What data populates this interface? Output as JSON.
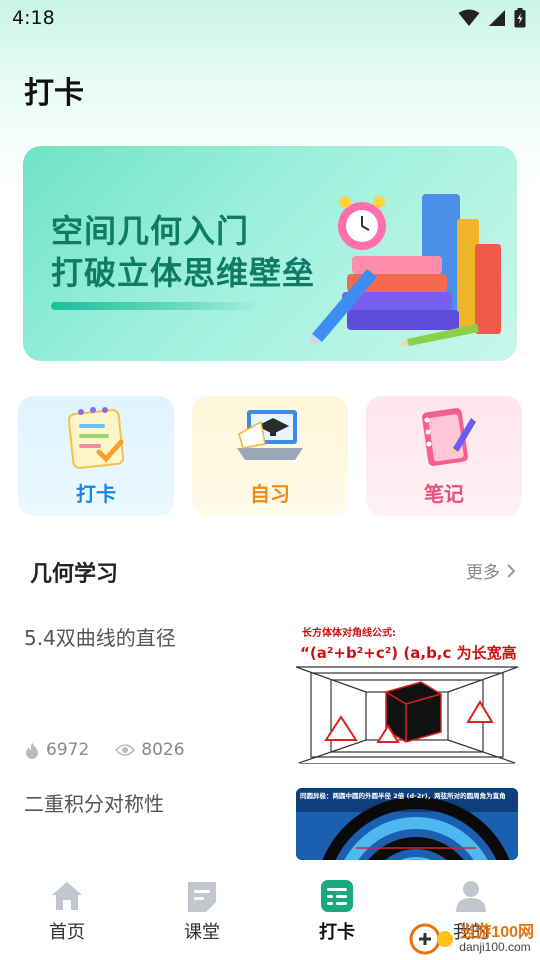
{
  "status_bar": {
    "time": "4:18"
  },
  "page": {
    "title": "打卡"
  },
  "banner": {
    "line1": "空间几何入门",
    "line2": "打破立体思维壁垒"
  },
  "feature_cards": [
    {
      "label": "打卡",
      "icon": "checklist-icon"
    },
    {
      "label": "自习",
      "icon": "laptop-graduation-icon"
    },
    {
      "label": "笔记",
      "icon": "notebook-icon"
    }
  ],
  "section": {
    "title": "几何学习",
    "more": "更多"
  },
  "articles": [
    {
      "title": "5.4双曲线的直径",
      "hot": "6972",
      "views": "8026",
      "thumb": {
        "heading": "长方体体对角线公式:",
        "formula": "“(a²+b²+c²) (a,b,c 为长宽高)"
      }
    },
    {
      "title": "二重积分对称性",
      "thumb": {
        "heading": "同圆异极：两圆中圆的外圆半径 2倍 (d-2r)，两弦所对的圆周角为直角"
      }
    }
  ],
  "tab_bar": [
    {
      "label": "首页",
      "icon": "home-icon"
    },
    {
      "label": "课堂",
      "icon": "classroom-icon"
    },
    {
      "label": "打卡",
      "icon": "checkin-icon"
    },
    {
      "label": "我的",
      "icon": "profile-icon"
    }
  ],
  "watermark": {
    "text": "danji100.com",
    "brand": "当游100网"
  },
  "colors": {
    "accent": "#19a97e",
    "banner_text": "#0f7a66",
    "card_blue": "#1f86e0",
    "card_orange": "#f08a12",
    "card_pink": "#ef4f7d"
  }
}
